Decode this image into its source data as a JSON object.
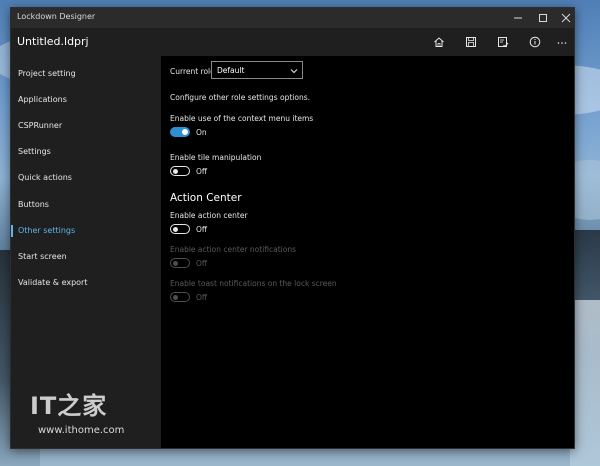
{
  "window": {
    "title": "Lockdown Designer"
  },
  "appbar": {
    "filename": "Untitled.ldprj",
    "icons": [
      "home-icon",
      "save-icon",
      "check-list-icon",
      "info-icon",
      "more-icon"
    ]
  },
  "sidebar": {
    "items": [
      {
        "label": "Project setting"
      },
      {
        "label": "Applications"
      },
      {
        "label": "CSPRunner"
      },
      {
        "label": "Settings"
      },
      {
        "label": "Quick actions"
      },
      {
        "label": "Buttons"
      },
      {
        "label": "Other settings",
        "active": true
      },
      {
        "label": "Start screen"
      },
      {
        "label": "Validate & export"
      }
    ]
  },
  "main": {
    "current_role_label": "Current role:",
    "current_role_value": "Default",
    "description": "Configure other role settings options.",
    "context_menu": {
      "label": "Enable use of the context menu items",
      "state": "On"
    },
    "tile_manipulation": {
      "label": "Enable tile manipulation",
      "state": "Off"
    },
    "action_center_heading": "Action Center",
    "action_center": {
      "label": "Enable action center",
      "state": "Off"
    },
    "action_center_notifications": {
      "label": "Enable action center notifications",
      "state": "Off"
    },
    "toast_notifications": {
      "label": "Enable toast notifications on the lock screen",
      "state": "Off"
    }
  },
  "watermark": {
    "url": "www.ithome.com"
  },
  "colors": {
    "accent": "#5fb4ea",
    "toggle_on": "#2e8fd3",
    "sidebar_bg": "#1f1f1f",
    "content_bg": "#000000"
  }
}
